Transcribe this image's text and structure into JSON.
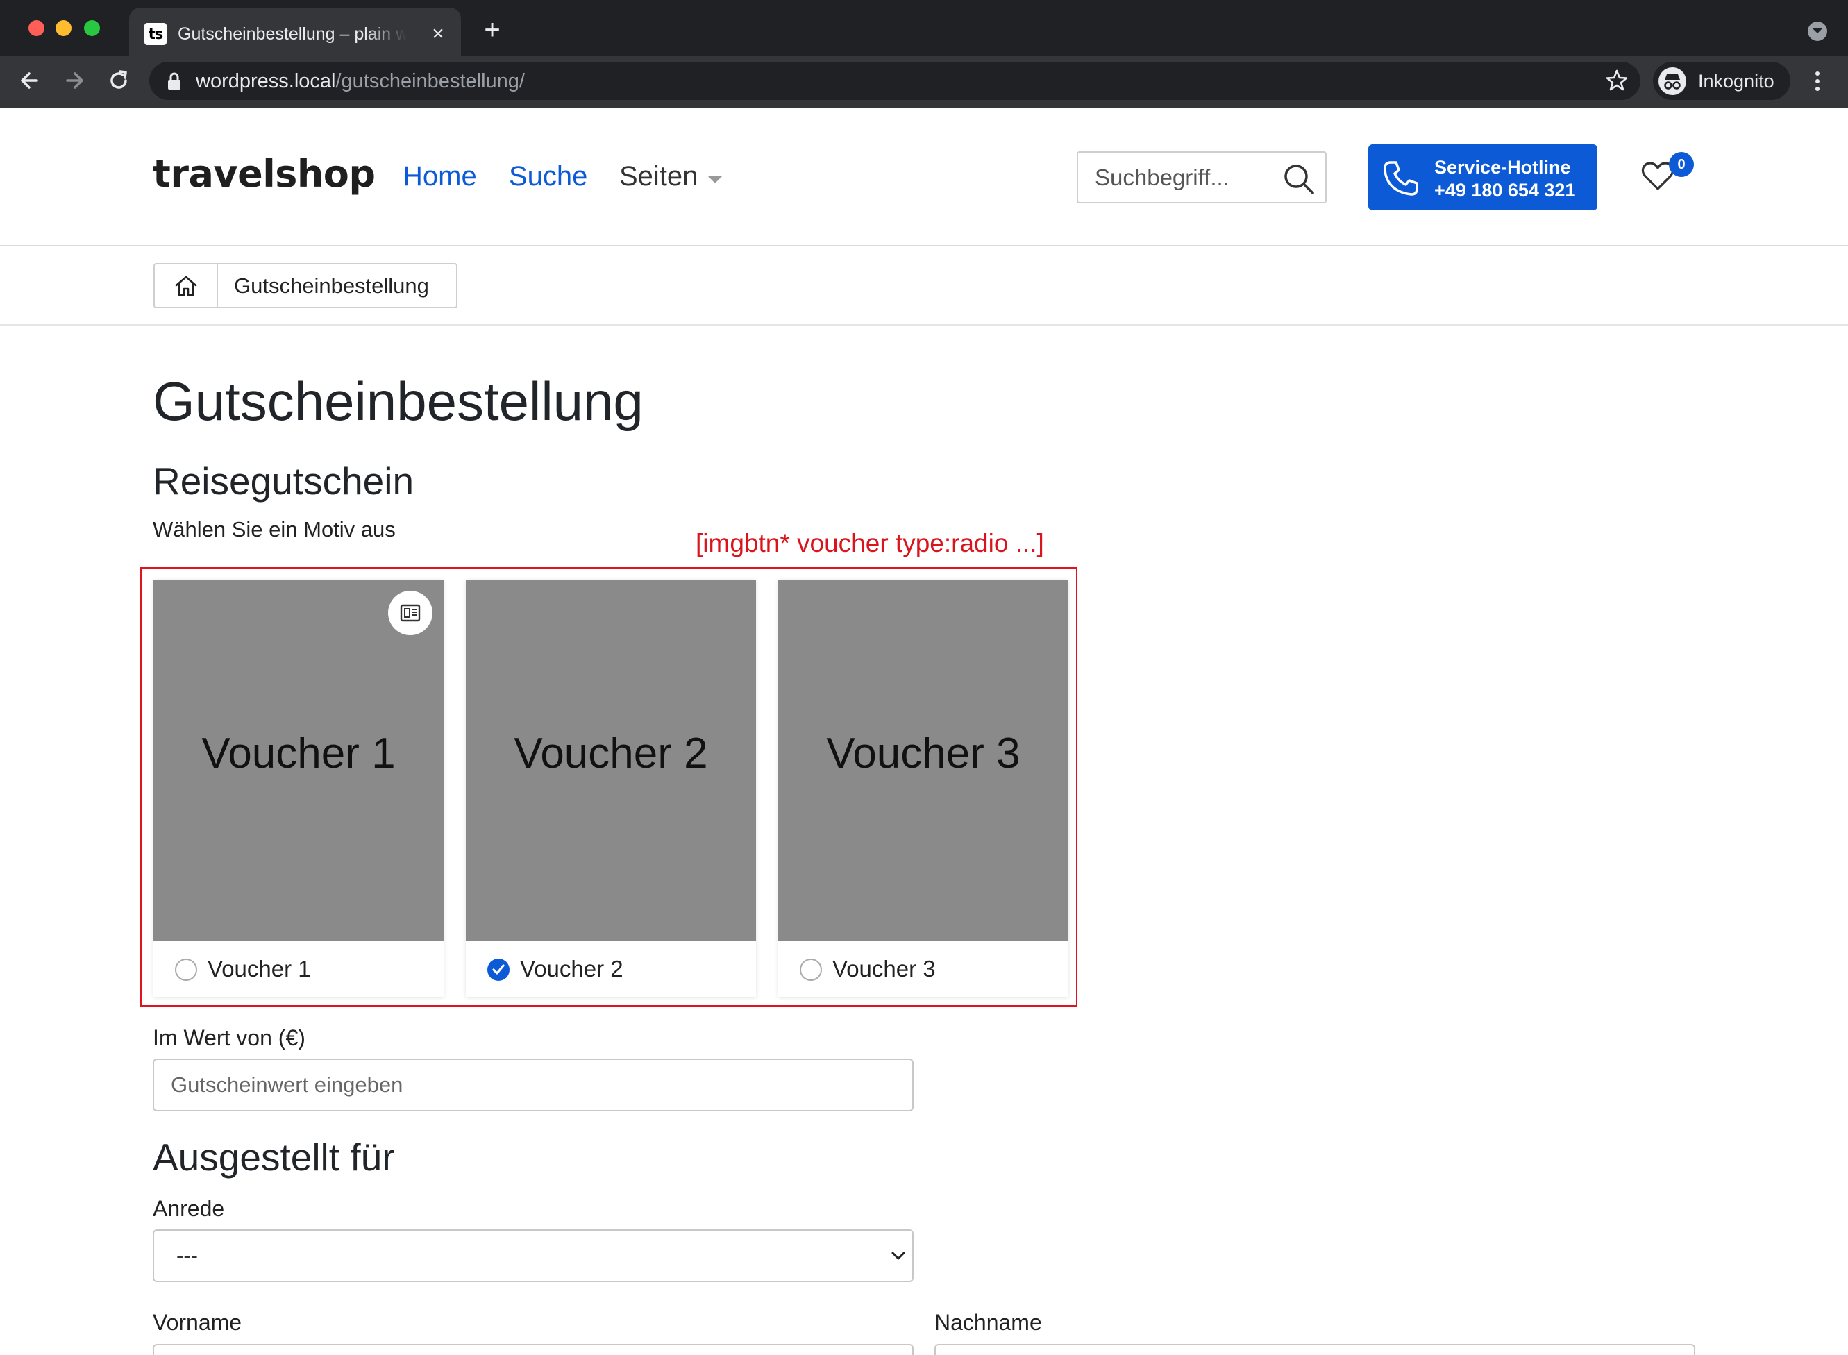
{
  "browser": {
    "tab_title": "Gutscheinbestellung – plain wordpress",
    "tab_favicon_text": "ts",
    "url_host": "wordpress.local",
    "url_path": "/gutscheinbestellung/",
    "profile_label": "Inkognito"
  },
  "header": {
    "logo": "travelshop",
    "nav": [
      {
        "label": "Home"
      },
      {
        "label": "Suche"
      },
      {
        "label": "Seiten"
      }
    ],
    "search_placeholder": "Suchbegriff...",
    "hotline_label": "Service-Hotline",
    "hotline_number": "+49 180 654 321",
    "wishlist_count": "0",
    "accent_color": "#0d5ad6"
  },
  "breadcrumb": {
    "current": "Gutscheinbestellung"
  },
  "main": {
    "title": "Gutscheinbestellung",
    "voucher_heading": "Reisegutschein",
    "voucher_lead": "Wählen Sie ein Motiv aus",
    "annotation": "[imgbtn* voucher type:radio ...]",
    "vouchers": [
      {
        "image_text": "Voucher 1",
        "label": "Voucher 1",
        "selected": false
      },
      {
        "image_text": "Voucher 2",
        "label": "Voucher 2",
        "selected": true
      },
      {
        "image_text": "Voucher 3",
        "label": "Voucher 3",
        "selected": false
      }
    ],
    "value_label": "Im Wert von (€)",
    "value_placeholder": "Gutscheinwert eingeben",
    "recipient_heading": "Ausgestellt für",
    "salutation_label": "Anrede",
    "salutation_value": "---",
    "firstname_label": "Vorname",
    "lastname_label": "Nachname"
  }
}
